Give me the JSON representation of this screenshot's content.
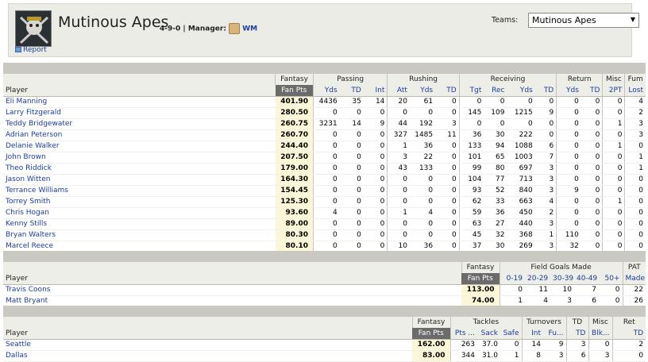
{
  "header": {
    "team_name": "Mutinous Apes",
    "record": "4-9-0",
    "separator": "|",
    "manager_label": "Manager:",
    "manager_name": "WM",
    "report_label": "Report",
    "teams_label": "Teams:",
    "teams_selected": "Mutinous Apes"
  },
  "offense": {
    "groups": [
      "Fantasy",
      "Passing",
      "Rushing",
      "Receiving",
      "Return",
      "Misc",
      "Fum"
    ],
    "columns": [
      "Player",
      "Fan Pts",
      "Yds",
      "TD",
      "Int",
      "Att",
      "Yds",
      "TD",
      "Tgt",
      "Rec",
      "Yds",
      "TD",
      "Yds",
      "TD",
      "2PT",
      "Lost"
    ],
    "rows": [
      [
        "Eli Manning",
        "401.90",
        "4436",
        "35",
        "14",
        "20",
        "61",
        "0",
        "0",
        "0",
        "0",
        "0",
        "0",
        "0",
        "0",
        "4"
      ],
      [
        "Larry Fitzgerald",
        "280.50",
        "0",
        "0",
        "0",
        "0",
        "0",
        "0",
        "145",
        "109",
        "1215",
        "9",
        "0",
        "0",
        "0",
        "2"
      ],
      [
        "Teddy Bridgewater",
        "260.75",
        "3231",
        "14",
        "9",
        "44",
        "192",
        "3",
        "0",
        "0",
        "0",
        "0",
        "0",
        "0",
        "1",
        "3"
      ],
      [
        "Adrian Peterson",
        "260.70",
        "0",
        "0",
        "0",
        "327",
        "1485",
        "11",
        "36",
        "30",
        "222",
        "0",
        "0",
        "0",
        "0",
        "3"
      ],
      [
        "Delanie Walker",
        "244.40",
        "0",
        "0",
        "0",
        "1",
        "36",
        "0",
        "133",
        "94",
        "1088",
        "6",
        "0",
        "0",
        "1",
        "0"
      ],
      [
        "John Brown",
        "207.50",
        "0",
        "0",
        "0",
        "3",
        "22",
        "0",
        "101",
        "65",
        "1003",
        "7",
        "0",
        "0",
        "0",
        "1"
      ],
      [
        "Theo Riddick",
        "179.00",
        "0",
        "0",
        "0",
        "43",
        "133",
        "0",
        "99",
        "80",
        "697",
        "3",
        "0",
        "0",
        "0",
        "1"
      ],
      [
        "Jason Witten",
        "164.30",
        "0",
        "0",
        "0",
        "0",
        "0",
        "0",
        "104",
        "77",
        "713",
        "3",
        "0",
        "0",
        "0",
        "0"
      ],
      [
        "Terrance Williams",
        "154.45",
        "0",
        "0",
        "0",
        "0",
        "0",
        "0",
        "93",
        "52",
        "840",
        "3",
        "9",
        "0",
        "0",
        "0"
      ],
      [
        "Torrey Smith",
        "125.30",
        "0",
        "0",
        "0",
        "0",
        "0",
        "0",
        "62",
        "33",
        "663",
        "4",
        "0",
        "0",
        "1",
        "0"
      ],
      [
        "Chris Hogan",
        "93.60",
        "4",
        "0",
        "0",
        "1",
        "4",
        "0",
        "59",
        "36",
        "450",
        "2",
        "0",
        "0",
        "0",
        "0"
      ],
      [
        "Kenny Stills",
        "89.00",
        "0",
        "0",
        "0",
        "0",
        "0",
        "0",
        "63",
        "27",
        "440",
        "3",
        "0",
        "0",
        "0",
        "0"
      ],
      [
        "Bryan Walters",
        "80.30",
        "0",
        "0",
        "0",
        "0",
        "0",
        "0",
        "45",
        "32",
        "368",
        "1",
        "110",
        "0",
        "0",
        "0"
      ],
      [
        "Marcel Reece",
        "80.10",
        "0",
        "0",
        "0",
        "10",
        "36",
        "0",
        "37",
        "30",
        "269",
        "3",
        "32",
        "0",
        "0",
        "0"
      ]
    ]
  },
  "kickers": {
    "groups": [
      "Fantasy",
      "Field Goals Made",
      "PAT"
    ],
    "columns": [
      "Player",
      "Fan Pts",
      "0-19",
      "20-29",
      "30-39",
      "40-49",
      "50+",
      "Made"
    ],
    "rows": [
      [
        "Travis Coons",
        "113.00",
        "0",
        "11",
        "10",
        "7",
        "0",
        "22"
      ],
      [
        "Matt Bryant",
        "74.00",
        "1",
        "4",
        "3",
        "6",
        "0",
        "26"
      ]
    ]
  },
  "defense": {
    "groups": [
      "Fantasy",
      "Tackles",
      "Turnovers",
      "TD",
      "Misc",
      "Ret"
    ],
    "columns": [
      "Player",
      "Fan Pts",
      "Pts ...",
      "Sack",
      "Safe",
      "Int",
      "Fu...",
      "TD",
      "Blk...",
      "TD"
    ],
    "rows": [
      [
        "Seattle",
        "162.00",
        "263",
        "37.0",
        "0",
        "14",
        "9",
        "3",
        "0",
        "2"
      ],
      [
        "Dallas",
        "83.00",
        "344",
        "31.0",
        "1",
        "8",
        "3",
        "6",
        "3",
        "0"
      ]
    ]
  }
}
